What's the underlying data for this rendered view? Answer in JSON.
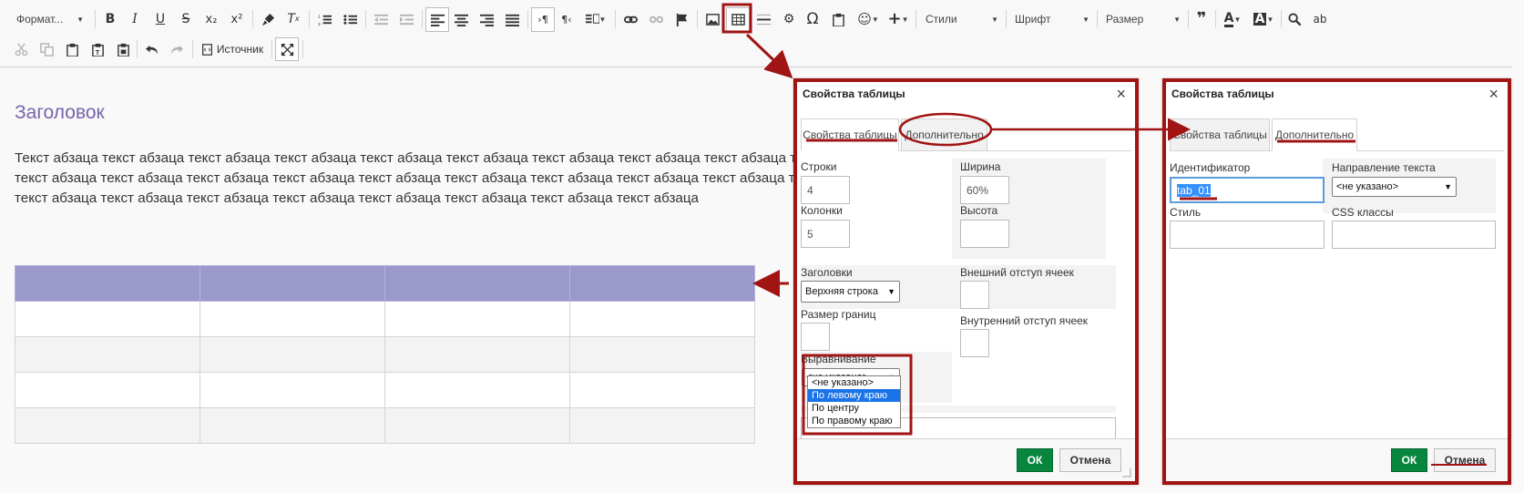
{
  "toolbar": {
    "format_label": "Формат...",
    "styles_label": "Стили",
    "font_label": "Шрифт",
    "size_label": "Размер",
    "source_label": "Источник",
    "icons": [
      "bold-icon",
      "italic-icon",
      "underline-icon",
      "strikethrough-icon",
      "subscript-icon",
      "superscript-icon",
      "copy-format-icon",
      "remove-format-icon",
      "numbered-list-icon",
      "bulleted-list-icon",
      "decrease-indent-icon",
      "increase-indent-icon",
      "align-left-icon",
      "align-center-icon",
      "align-right-icon",
      "justify-icon",
      "ltr-icon",
      "rtl-icon",
      "language-icon",
      "link-icon",
      "unlink-icon",
      "anchor-icon",
      "image-icon",
      "table-icon",
      "horizontal-line-icon",
      "special-char-icon",
      "omega-icon",
      "paste-icon",
      "emoji-icon",
      "insert-icon",
      "blockquote-icon",
      "text-color-icon",
      "bg-color-icon",
      "find-icon",
      "replace-icon",
      "cut-icon",
      "copy-icon",
      "paste-icon",
      "paste-text-icon",
      "paste-word-icon",
      "undo-icon",
      "redo-icon",
      "source-icon",
      "maximize-icon"
    ],
    "glyphs": {
      "bold": "B",
      "italic": "I",
      "underline": "U",
      "strike": "S",
      "subscript": "x₂",
      "superscript": "x²",
      "quote": "❞",
      "omega": "Ω",
      "text_color": "A",
      "bg_color": "A",
      "find": "⌕",
      "replace": "ab"
    }
  },
  "content": {
    "heading": "Заголовок",
    "paragraph": "Текст абзаца текст абзаца текст абзаца текст абзаца текст абзаца текст абзаца текст абзаца текст абзаца текст абзаца текст абзаца текст абзаца текст абзаца текст абзаца текст абзаца текст абзаца текст абзаца текст абзаца текст абзаца текст абзаца текст абзаца текст абзаца текст абзаца текст абзаца текст абзаца текст абзаца текст абзаца текст абзаца текст абзаца текст абзаца текст абзаца текст абзаца текст абзаца текст абзаца текст абзаца"
  },
  "dialog1": {
    "title": "Свойства таблицы",
    "close": "×",
    "tab_props": "Свойства таблицы",
    "tab_advanced": "Дополнительно",
    "rows_label": "Строки",
    "rows_value": "4",
    "cols_label": "Колонки",
    "cols_value": "5",
    "width_label": "Ширина",
    "width_value": "60%",
    "height_label": "Высота",
    "headers_label": "Заголовки",
    "headers_value": "Верхняя строка",
    "border_label": "Размер границ",
    "spacing_label": "Внешний отступ ячеек",
    "padding_label": "Внутренний отступ ячеек",
    "align_label": "Выравнивание",
    "align_value": "<не указано>",
    "align_options": [
      "<не указано>",
      "По левому краю",
      "По центру",
      "По правому краю"
    ],
    "ok": "ОК",
    "cancel": "Отмена"
  },
  "dialog2": {
    "title": "Свойства таблицы",
    "close": "×",
    "tab_props": "Свойства таблицы",
    "tab_advanced": "Дополнительно",
    "id_label": "Идентификатор",
    "id_value": "tab_01",
    "dir_label": "Направление текста",
    "dir_value": "<не указано>",
    "style_label": "Стиль",
    "css_label": "CSS классы",
    "ok": "ОК",
    "cancel": "Отмена"
  },
  "colors": {
    "accent_red": "#a01414",
    "heading": "#7764aa",
    "table_header": "#9b99cc",
    "ok_green": "#09863e"
  }
}
